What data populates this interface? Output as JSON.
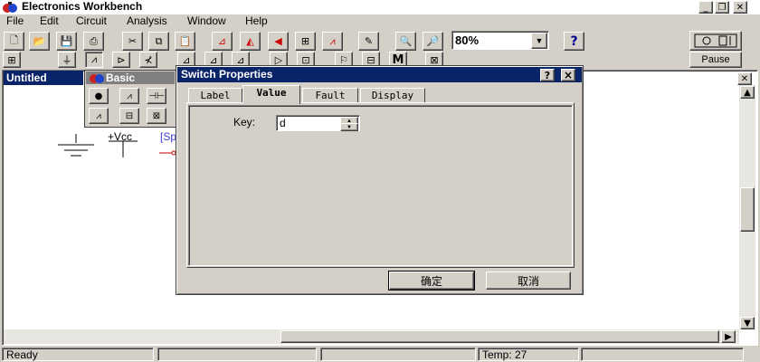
{
  "app": {
    "title": "Electronics Workbench"
  },
  "menu": [
    "File",
    "Edit",
    "Circuit",
    "Analysis",
    "Window",
    "Help"
  ],
  "toolbar": {
    "zoom": "80%",
    "help_label": "?",
    "pause_label": "Pause",
    "meter_label": "M"
  },
  "document": {
    "title": "Untitled"
  },
  "circuit": {
    "vcc_label": "+Vcc",
    "switch_label": "[Sp"
  },
  "palette": {
    "title": "Basic"
  },
  "dialog": {
    "title": "Switch Properties",
    "help": "?",
    "close": "×",
    "tabs": [
      "Label",
      "Value",
      "Fault",
      "Display"
    ],
    "key_label": "Key:",
    "key_value": "d",
    "ok_label": "确定",
    "cancel_label": "取消"
  },
  "status": {
    "left": "Ready",
    "temp": "Temp:  27"
  },
  "colors": {
    "title_active": "#0a246a",
    "workspace": "#ffffff",
    "chrome": "#d4d0c8",
    "circuit_blue": "#3b3bd9",
    "wire_red": "#cc0000"
  }
}
